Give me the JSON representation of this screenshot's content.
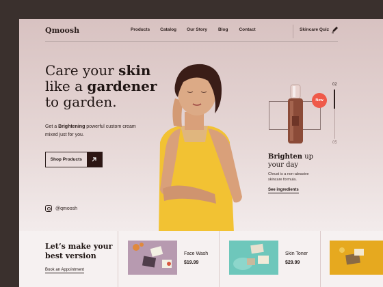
{
  "brand": {
    "logo": "Qmoosh"
  },
  "nav": {
    "items": [
      "Products",
      "Catalog",
      "Our Story",
      "Blog",
      "Contact"
    ],
    "quiz": "Skincare Quiz"
  },
  "hero": {
    "line1_a": "Care your ",
    "line1_b": "skin",
    "line2_a": "like a ",
    "line2_b": "gardener",
    "line3": "to garden.",
    "sub_a": "Get a ",
    "sub_b": "Brightening",
    "sub_c": " powerful custom cream mixed just for you.",
    "cta": "Shop Products",
    "instagram": "@qmoosh"
  },
  "featured": {
    "badge": "New",
    "pager_current": "02",
    "pager_total": "05",
    "title_a": "Brighten",
    "title_b": " up",
    "title_c": "your day",
    "description": "Chrust is a non-abrasive skincare formula.",
    "link": "See ingredients"
  },
  "promo": {
    "title": "Let’s make your best version",
    "link": "Book an Appointment"
  },
  "products": [
    {
      "name": "Face Wash",
      "price": "$19.99"
    },
    {
      "name": "Skin Toner",
      "price": "$29.99"
    }
  ],
  "colors": {
    "accent": "#ef5a4a",
    "dark": "#2c1613",
    "dress": "#f2c233"
  }
}
